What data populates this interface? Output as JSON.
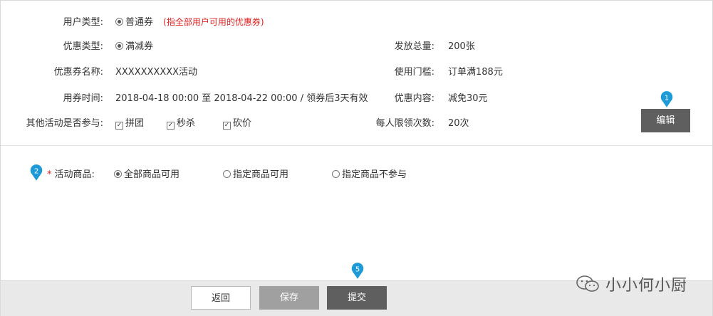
{
  "info": {
    "user_type": {
      "label": "用户类型:",
      "value": "普通券",
      "note": "(指全部用户可用的优惠券)"
    },
    "coupon_type": {
      "label": "优惠类型:",
      "value": "满减券"
    },
    "coupon_name": {
      "label": "优惠券名称:",
      "value": "XXXXXXXXXX活动"
    },
    "use_time": {
      "label": "用券时间:",
      "value": "2018-04-18 00:00 至 2018-04-22 00:00 / 领券后3天有效"
    },
    "other_activities": {
      "label": "其他活动是否参与:",
      "options": [
        "拼团",
        "秒杀",
        "砍价"
      ]
    },
    "total_issued": {
      "label": "发放总量:",
      "value": "200张"
    },
    "threshold": {
      "label": "使用门槛:",
      "value": "订单满188元"
    },
    "discount_content": {
      "label": "优惠内容:",
      "value": "减免30元"
    },
    "limit_per_person": {
      "label": "每人限领次数:",
      "value": "20次"
    }
  },
  "edit_button": "编辑",
  "goods": {
    "required_mark": "*",
    "label": "活动商品:",
    "options": [
      "全部商品可用",
      "指定商品可用",
      "指定商品不参与"
    ],
    "selected_index": 0
  },
  "footer": {
    "back": "返回",
    "save": "保存",
    "submit": "提交"
  },
  "markers": [
    "1",
    "2",
    "5"
  ],
  "watermark": "小小何小厨",
  "colors": {
    "marker": "#1e9bd7",
    "dark_button": "#5f5f5f",
    "disabled_button": "#a0a0a0",
    "note": "#e02020"
  }
}
